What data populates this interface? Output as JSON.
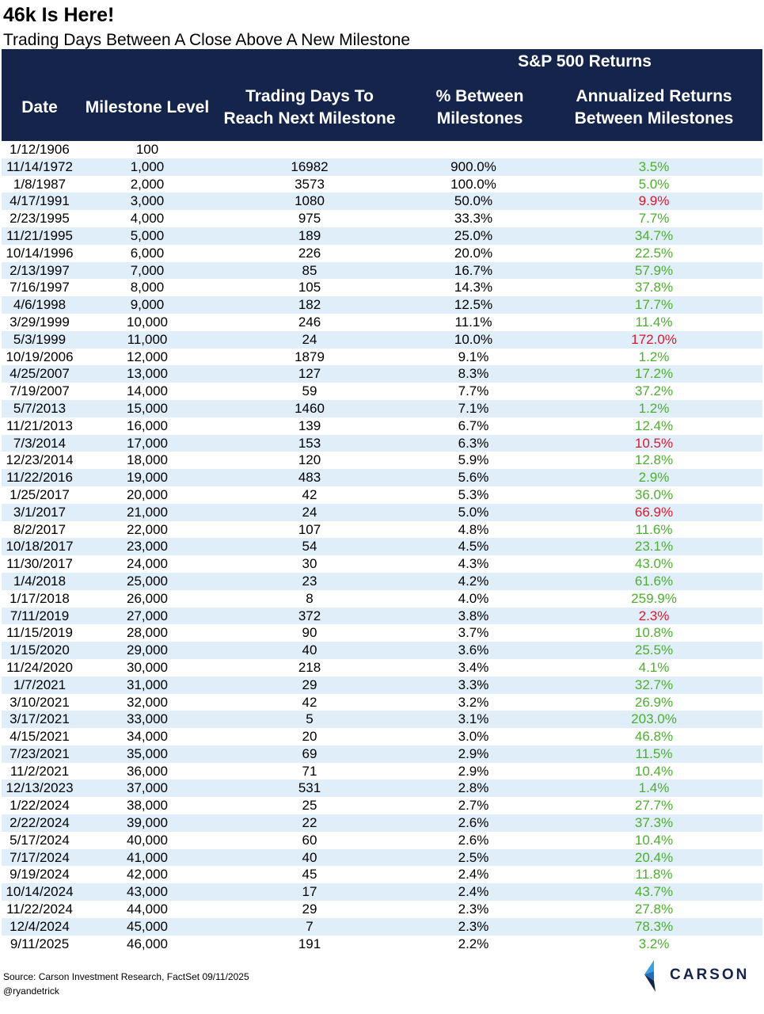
{
  "title": "46k Is Here!",
  "subtitle": "Trading Days Between A Close Above A New Milestone",
  "header": {
    "group": "S&P 500 Returns",
    "date": "Date",
    "milestone": "Milestone Level",
    "days_line1": "Trading Days To",
    "days_line2": "Reach Next Milestone",
    "pct_line1": "% Between",
    "pct_line2": "Milestones",
    "ann_line1": "Annualized Returns",
    "ann_line2": "Between Milestones"
  },
  "footer": {
    "source": "Source: Carson Investment Research, FactSet 09/11/2025",
    "handle": "@ryandetrick",
    "logo_text": "CARSON"
  },
  "colors": {
    "header_bg": "#15244b",
    "row_alt": "#dfeef9",
    "positive": "#4caf2e",
    "negative": "#e0162b"
  },
  "chart_data": {
    "type": "table",
    "columns": [
      "Date",
      "Milestone Level",
      "Trading Days To Reach Next Milestone",
      "% Between Milestones",
      "Annualized Returns Between Milestones"
    ],
    "rows": [
      {
        "date": "1/12/1906",
        "milestone": "100",
        "days": "",
        "pct": "",
        "ann": "",
        "neg": false
      },
      {
        "date": "11/14/1972",
        "milestone": "1,000",
        "days": "16982",
        "pct": "900.0%",
        "ann": "3.5%",
        "neg": false
      },
      {
        "date": "1/8/1987",
        "milestone": "2,000",
        "days": "3573",
        "pct": "100.0%",
        "ann": "5.0%",
        "neg": false
      },
      {
        "date": "4/17/1991",
        "milestone": "3,000",
        "days": "1080",
        "pct": "50.0%",
        "ann": "9.9%",
        "neg": true
      },
      {
        "date": "2/23/1995",
        "milestone": "4,000",
        "days": "975",
        "pct": "33.3%",
        "ann": "7.7%",
        "neg": false
      },
      {
        "date": "11/21/1995",
        "milestone": "5,000",
        "days": "189",
        "pct": "25.0%",
        "ann": "34.7%",
        "neg": false
      },
      {
        "date": "10/14/1996",
        "milestone": "6,000",
        "days": "226",
        "pct": "20.0%",
        "ann": "22.5%",
        "neg": false
      },
      {
        "date": "2/13/1997",
        "milestone": "7,000",
        "days": "85",
        "pct": "16.7%",
        "ann": "57.9%",
        "neg": false
      },
      {
        "date": "7/16/1997",
        "milestone": "8,000",
        "days": "105",
        "pct": "14.3%",
        "ann": "37.8%",
        "neg": false
      },
      {
        "date": "4/6/1998",
        "milestone": "9,000",
        "days": "182",
        "pct": "12.5%",
        "ann": "17.7%",
        "neg": false
      },
      {
        "date": "3/29/1999",
        "milestone": "10,000",
        "days": "246",
        "pct": "11.1%",
        "ann": "11.4%",
        "neg": false
      },
      {
        "date": "5/3/1999",
        "milestone": "11,000",
        "days": "24",
        "pct": "10.0%",
        "ann": "172.0%",
        "neg": true
      },
      {
        "date": "10/19/2006",
        "milestone": "12,000",
        "days": "1879",
        "pct": "9.1%",
        "ann": "1.2%",
        "neg": false
      },
      {
        "date": "4/25/2007",
        "milestone": "13,000",
        "days": "127",
        "pct": "8.3%",
        "ann": "17.2%",
        "neg": false
      },
      {
        "date": "7/19/2007",
        "milestone": "14,000",
        "days": "59",
        "pct": "7.7%",
        "ann": "37.2%",
        "neg": false
      },
      {
        "date": "5/7/2013",
        "milestone": "15,000",
        "days": "1460",
        "pct": "7.1%",
        "ann": "1.2%",
        "neg": false
      },
      {
        "date": "11/21/2013",
        "milestone": "16,000",
        "days": "139",
        "pct": "6.7%",
        "ann": "12.4%",
        "neg": false
      },
      {
        "date": "7/3/2014",
        "milestone": "17,000",
        "days": "153",
        "pct": "6.3%",
        "ann": "10.5%",
        "neg": true
      },
      {
        "date": "12/23/2014",
        "milestone": "18,000",
        "days": "120",
        "pct": "5.9%",
        "ann": "12.8%",
        "neg": false
      },
      {
        "date": "11/22/2016",
        "milestone": "19,000",
        "days": "483",
        "pct": "5.6%",
        "ann": "2.9%",
        "neg": false
      },
      {
        "date": "1/25/2017",
        "milestone": "20,000",
        "days": "42",
        "pct": "5.3%",
        "ann": "36.0%",
        "neg": false
      },
      {
        "date": "3/1/2017",
        "milestone": "21,000",
        "days": "24",
        "pct": "5.0%",
        "ann": "66.9%",
        "neg": true
      },
      {
        "date": "8/2/2017",
        "milestone": "22,000",
        "days": "107",
        "pct": "4.8%",
        "ann": "11.6%",
        "neg": false
      },
      {
        "date": "10/18/2017",
        "milestone": "23,000",
        "days": "54",
        "pct": "4.5%",
        "ann": "23.1%",
        "neg": false
      },
      {
        "date": "11/30/2017",
        "milestone": "24,000",
        "days": "30",
        "pct": "4.3%",
        "ann": "43.0%",
        "neg": false
      },
      {
        "date": "1/4/2018",
        "milestone": "25,000",
        "days": "23",
        "pct": "4.2%",
        "ann": "61.6%",
        "neg": false
      },
      {
        "date": "1/17/2018",
        "milestone": "26,000",
        "days": "8",
        "pct": "4.0%",
        "ann": "259.9%",
        "neg": false
      },
      {
        "date": "7/11/2019",
        "milestone": "27,000",
        "days": "372",
        "pct": "3.8%",
        "ann": "2.3%",
        "neg": true
      },
      {
        "date": "11/15/2019",
        "milestone": "28,000",
        "days": "90",
        "pct": "3.7%",
        "ann": "10.8%",
        "neg": false
      },
      {
        "date": "1/15/2020",
        "milestone": "29,000",
        "days": "40",
        "pct": "3.6%",
        "ann": "25.5%",
        "neg": false
      },
      {
        "date": "11/24/2020",
        "milestone": "30,000",
        "days": "218",
        "pct": "3.4%",
        "ann": "4.1%",
        "neg": false
      },
      {
        "date": "1/7/2021",
        "milestone": "31,000",
        "days": "29",
        "pct": "3.3%",
        "ann": "32.7%",
        "neg": false
      },
      {
        "date": "3/10/2021",
        "milestone": "32,000",
        "days": "42",
        "pct": "3.2%",
        "ann": "26.9%",
        "neg": false
      },
      {
        "date": "3/17/2021",
        "milestone": "33,000",
        "days": "5",
        "pct": "3.1%",
        "ann": "203.0%",
        "neg": false
      },
      {
        "date": "4/15/2021",
        "milestone": "34,000",
        "days": "20",
        "pct": "3.0%",
        "ann": "46.8%",
        "neg": false
      },
      {
        "date": "7/23/2021",
        "milestone": "35,000",
        "days": "69",
        "pct": "2.9%",
        "ann": "11.5%",
        "neg": false
      },
      {
        "date": "11/2/2021",
        "milestone": "36,000",
        "days": "71",
        "pct": "2.9%",
        "ann": "10.4%",
        "neg": false
      },
      {
        "date": "12/13/2023",
        "milestone": "37,000",
        "days": "531",
        "pct": "2.8%",
        "ann": "1.4%",
        "neg": false
      },
      {
        "date": "1/22/2024",
        "milestone": "38,000",
        "days": "25",
        "pct": "2.7%",
        "ann": "27.7%",
        "neg": false
      },
      {
        "date": "2/22/2024",
        "milestone": "39,000",
        "days": "22",
        "pct": "2.6%",
        "ann": "37.3%",
        "neg": false
      },
      {
        "date": "5/17/2024",
        "milestone": "40,000",
        "days": "60",
        "pct": "2.6%",
        "ann": "10.4%",
        "neg": false
      },
      {
        "date": "7/17/2024",
        "milestone": "41,000",
        "days": "40",
        "pct": "2.5%",
        "ann": "20.4%",
        "neg": false
      },
      {
        "date": "9/19/2024",
        "milestone": "42,000",
        "days": "45",
        "pct": "2.4%",
        "ann": "11.8%",
        "neg": false
      },
      {
        "date": "10/14/2024",
        "milestone": "43,000",
        "days": "17",
        "pct": "2.4%",
        "ann": "43.7%",
        "neg": false
      },
      {
        "date": "11/22/2024",
        "milestone": "44,000",
        "days": "29",
        "pct": "2.3%",
        "ann": "27.8%",
        "neg": false
      },
      {
        "date": "12/4/2024",
        "milestone": "45,000",
        "days": "7",
        "pct": "2.3%",
        "ann": "78.3%",
        "neg": false
      },
      {
        "date": "9/11/2025",
        "milestone": "46,000",
        "days": "191",
        "pct": "2.2%",
        "ann": "3.2%",
        "neg": false
      }
    ]
  }
}
